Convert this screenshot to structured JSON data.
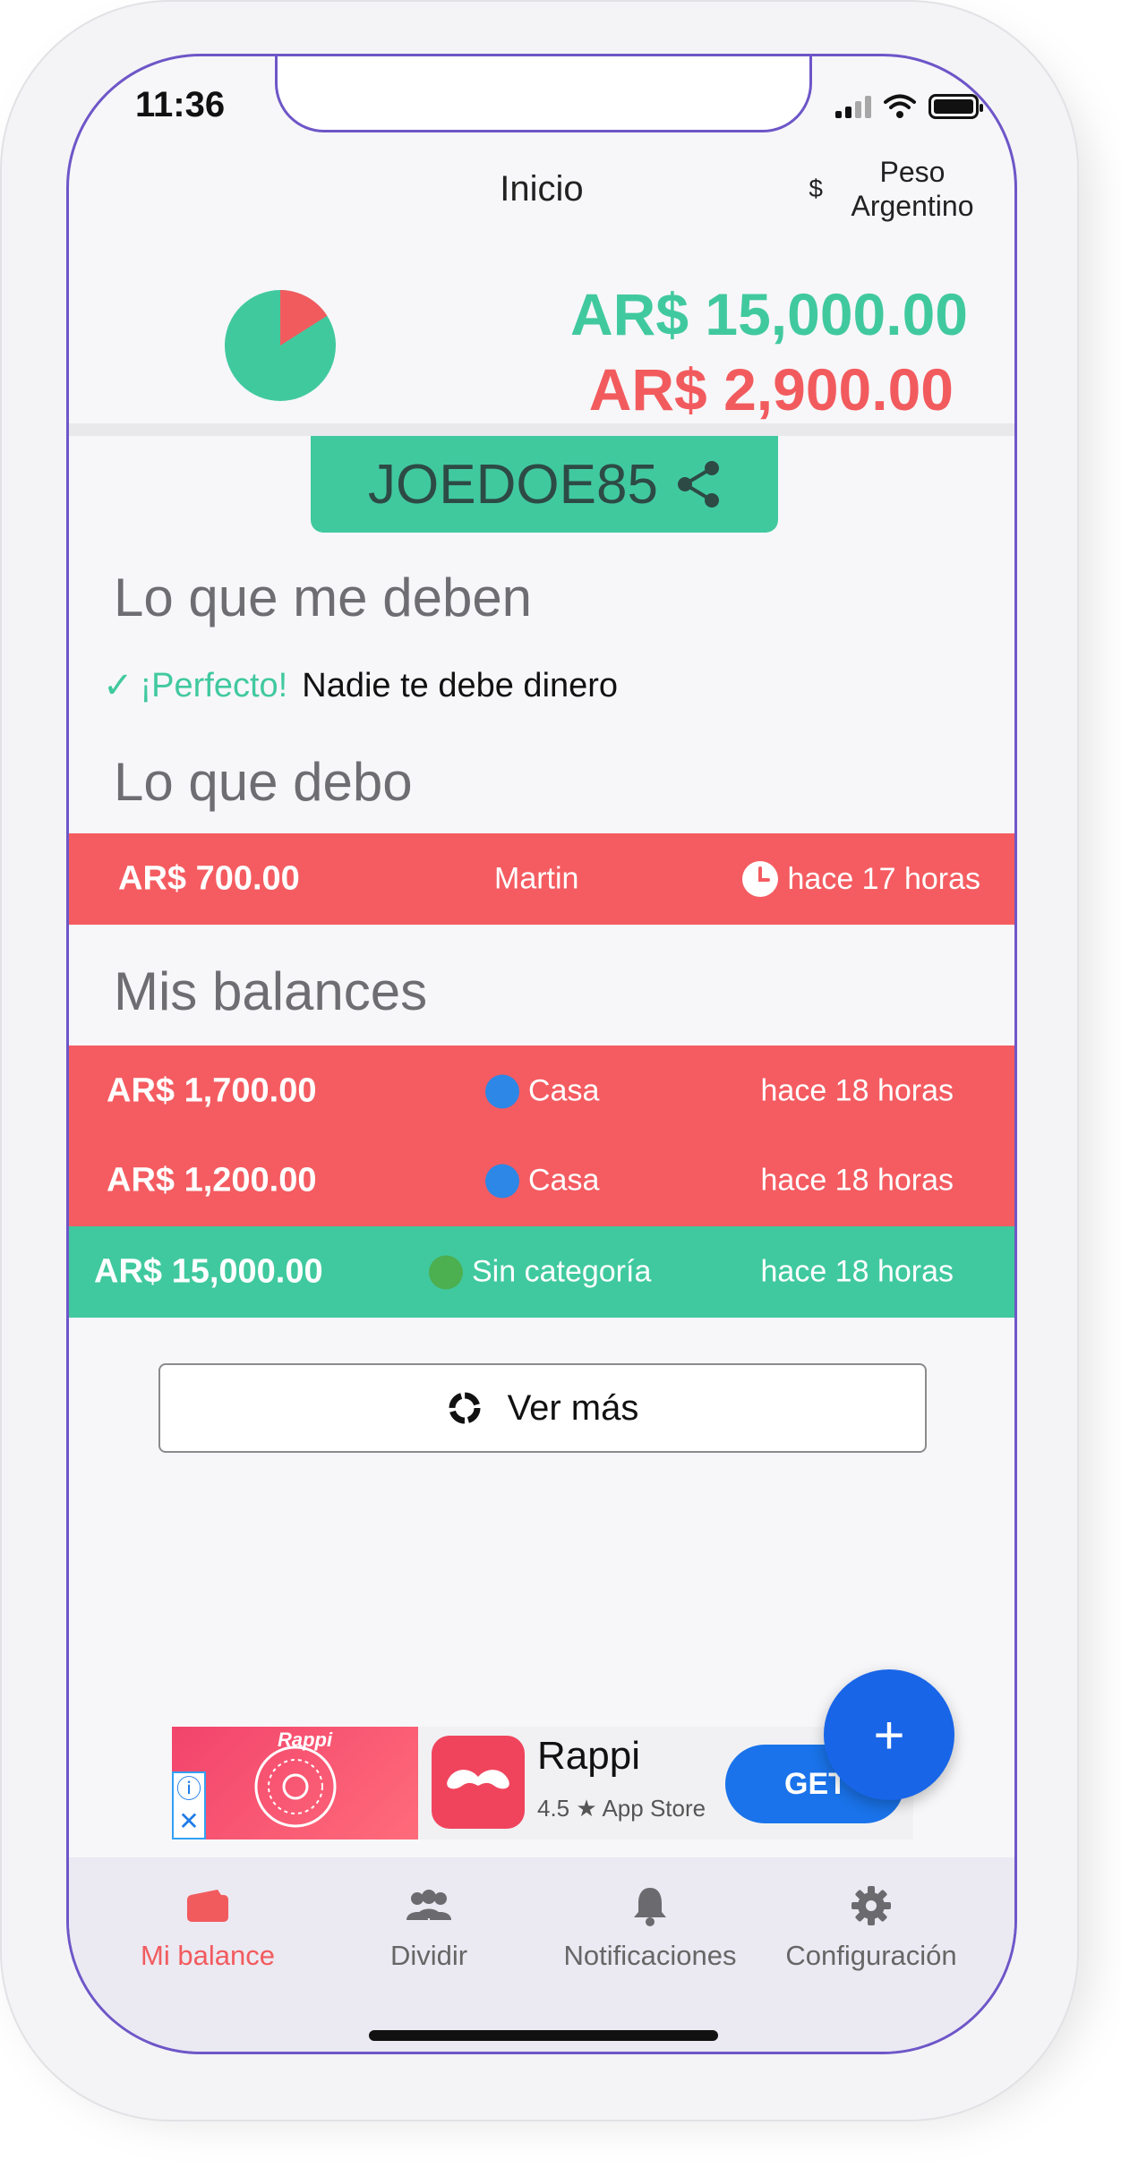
{
  "status_bar": {
    "time": "11:36"
  },
  "header": {
    "title": "Inicio",
    "currency_symbol": "$",
    "currency_line1": "Peso",
    "currency_line2": "Argentino"
  },
  "summary": {
    "owed_to_me_total": "AR$ 15,000.00",
    "i_owe_total": "AR$ 2,900.00",
    "pie_red_fraction": 0.16,
    "colors": {
      "green": "#41c99e",
      "red": "#f25b5e"
    }
  },
  "share": {
    "code": "JOEDOE85"
  },
  "owed_to_me": {
    "title": "Lo que me deben",
    "empty_lead": "¡Perfecto!",
    "empty_rest": "Nadie te debe dinero"
  },
  "i_owe": {
    "title": "Lo que debo",
    "rows": [
      {
        "amount": "AR$ 700.00",
        "person": "Martin",
        "time": "hace 17 horas"
      }
    ]
  },
  "balances": {
    "title": "Mis balances",
    "rows": [
      {
        "amount": "AR$ 1,700.00",
        "category": "Casa",
        "time": "hace 18 horas",
        "status": "red",
        "dot_color": "#2d87e6"
      },
      {
        "amount": "AR$ 1,200.00",
        "category": "Casa",
        "time": "hace 18 horas",
        "status": "red",
        "dot_color": "#2d87e6"
      },
      {
        "amount": "AR$ 15,000.00",
        "category": "Sin categoría",
        "time": "hace 18 horas",
        "status": "green",
        "dot_color": "#4caf50"
      }
    ]
  },
  "more_button": {
    "label": "Ver más"
  },
  "ad": {
    "brand_small": "Rappi",
    "app_name": "Rappi",
    "rating": "4.5 ★ App Store",
    "cta": "GET",
    "info_icon": "info-icon",
    "close_icon": "close-icon"
  },
  "fab": {
    "label": "+"
  },
  "bottom_nav": {
    "items": [
      {
        "label": "Mi balance",
        "icon": "wallet-icon",
        "active": true
      },
      {
        "label": "Dividir",
        "icon": "group-icon",
        "active": false
      },
      {
        "label": "Notificaciones",
        "icon": "bell-icon",
        "active": false
      },
      {
        "label": "Configuración",
        "icon": "gear-icon",
        "active": false
      }
    ]
  }
}
